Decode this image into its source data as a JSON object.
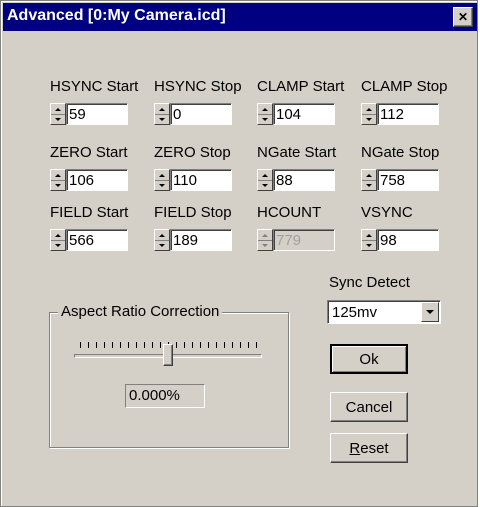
{
  "window": {
    "title": "Advanced [0:My Camera.icd]",
    "close_glyph": "✕"
  },
  "fields": [
    {
      "label": "HSYNC Start",
      "value": "59",
      "enabled": true
    },
    {
      "label": "HSYNC Stop",
      "value": "0",
      "enabled": true
    },
    {
      "label": "CLAMP Start",
      "value": "104",
      "enabled": true
    },
    {
      "label": "CLAMP Stop",
      "value": "112",
      "enabled": true
    },
    {
      "label": "ZERO Start",
      "value": "106",
      "enabled": true
    },
    {
      "label": "ZERO Stop",
      "value": "110",
      "enabled": true
    },
    {
      "label": "NGate Start",
      "value": "88",
      "enabled": true
    },
    {
      "label": "NGate Stop",
      "value": "758",
      "enabled": true
    },
    {
      "label": "FIELD Start",
      "value": "566",
      "enabled": true
    },
    {
      "label": "FIELD Stop",
      "value": "189",
      "enabled": true
    },
    {
      "label": "HCOUNT",
      "value": "779",
      "enabled": false
    },
    {
      "label": "VSYNC",
      "value": "98",
      "enabled": true
    }
  ],
  "sync_detect": {
    "label": "Sync Detect",
    "value": "125mv"
  },
  "aspect_ratio": {
    "group_title": "Aspect Ratio Correction",
    "readout": "0.000%",
    "slider_fraction": 0.5
  },
  "buttons": {
    "ok": "Ok",
    "cancel": "Cancel",
    "reset_prefix": "R",
    "reset_rest": "eset"
  }
}
